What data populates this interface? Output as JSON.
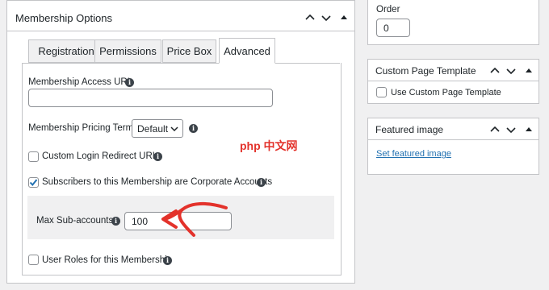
{
  "membership": {
    "title": "Membership Options",
    "tabs": [
      {
        "label": "Registration"
      },
      {
        "label": "Permissions"
      },
      {
        "label": "Price Box"
      },
      {
        "label": "Advanced"
      }
    ],
    "access_url_label": "Membership Access URL",
    "access_url_value": "",
    "pricing_terms_label": "Membership Pricing Terms:",
    "pricing_terms_selected": "Default",
    "custom_login_label": "Custom Login Redirect URLs",
    "custom_login_checked": false,
    "corporate_label": "Subscribers to this Membership are Corporate Accounts",
    "corporate_checked": true,
    "max_sub_label": "Max Sub-accounts",
    "max_sub_value": "100",
    "user_roles_label": "User Roles for this Membership",
    "user_roles_checked": false
  },
  "order": {
    "label": "Order",
    "value": "0"
  },
  "custom_template": {
    "title": "Custom Page Template",
    "checkbox_label": "Use Custom Page Template",
    "checked": false
  },
  "featured_image": {
    "title": "Featured image",
    "link": "Set featured image"
  },
  "watermark": "php 中文网",
  "colors": {
    "accent": "#2271b1",
    "arrow": "#e3322b",
    "border": "#c3c4c7",
    "background": "#f0f0f1"
  }
}
